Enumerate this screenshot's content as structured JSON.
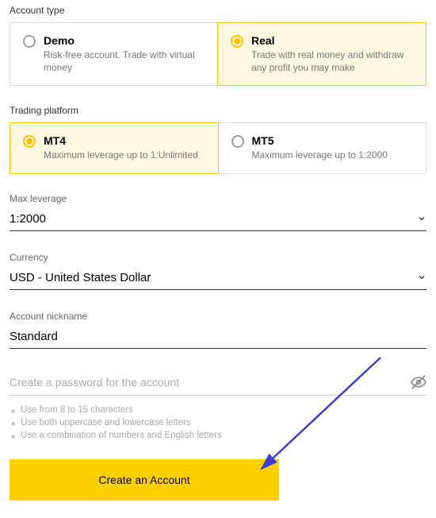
{
  "accountType": {
    "label": "Account type",
    "options": [
      {
        "title": "Demo",
        "desc": "Risk-free account. Trade with virtual money"
      },
      {
        "title": "Real",
        "desc": "Trade with real money and withdraw any profit you may make"
      }
    ],
    "selectedIndex": 1
  },
  "platform": {
    "label": "Trading platform",
    "options": [
      {
        "title": "MT4",
        "desc": "Maximum leverage up to 1:Unlimited"
      },
      {
        "title": "MT5",
        "desc": "Maximum leverage up to 1:2000"
      }
    ],
    "selectedIndex": 0
  },
  "leverage": {
    "label": "Max leverage",
    "value": "1:2000"
  },
  "currency": {
    "label": "Currency",
    "value": "USD - United States Dollar"
  },
  "nickname": {
    "label": "Account nickname",
    "value": "Standard"
  },
  "password": {
    "placeholder": "Create a password for the account",
    "rules": [
      "Use from 8 to 15 characters",
      "Use both uppercase and lowercase letters",
      "Use a combination of numbers and English letters"
    ]
  },
  "submit": {
    "label": "Create an Account"
  },
  "colors": {
    "accent": "#ffcf01",
    "selectedBg": "#fff8e1"
  }
}
